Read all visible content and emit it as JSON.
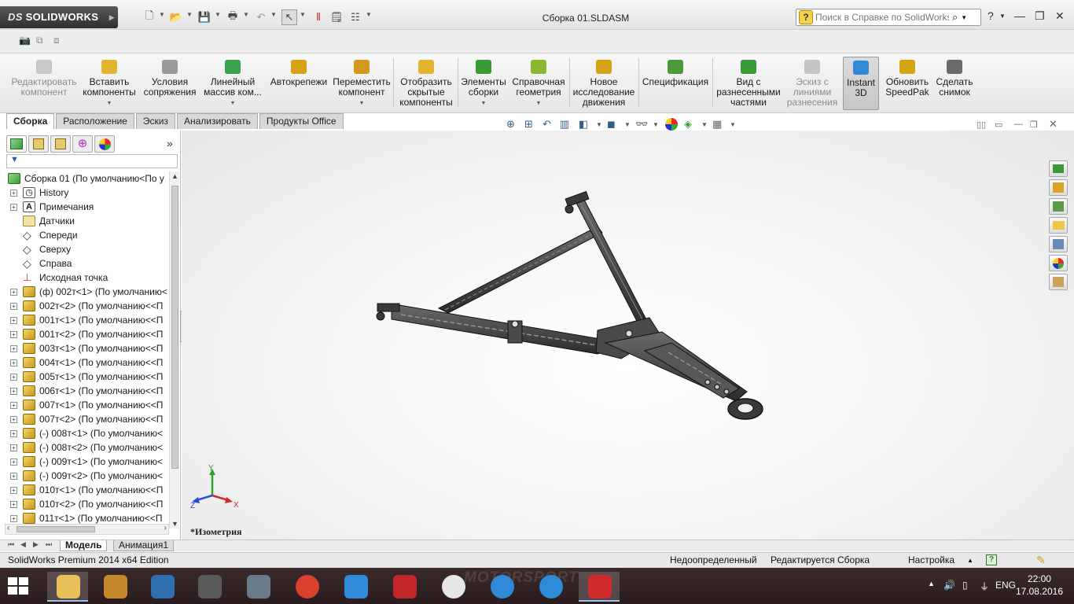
{
  "app": {
    "logo_text": "SOLIDWORKS",
    "logo_prefix": "DS",
    "document_title": "Сборка 01.SLDASM"
  },
  "help_search": {
    "placeholder": "Поиск в Справке по SolidWorks",
    "icon": "question-icon"
  },
  "command_manager": {
    "items": [
      {
        "label": "Редактировать\nкомпонент",
        "enabled": false,
        "dropdown": false,
        "icon_color": "#bdbdbd"
      },
      {
        "label": "Вставить\nкомпоненты",
        "enabled": true,
        "dropdown": true,
        "icon_color": "#e2b530"
      },
      {
        "label": "Условия\nсопряжения",
        "enabled": true,
        "dropdown": false,
        "icon_color": "#7a7a7a"
      },
      {
        "label": "Линейный\nмассив ком...",
        "enabled": true,
        "dropdown": true,
        "icon_color": "#3aa34a"
      },
      {
        "label": "Автокрепежи",
        "enabled": true,
        "dropdown": false,
        "icon_color": "#d4a414"
      },
      {
        "label": "Переместить\nкомпонент",
        "enabled": true,
        "dropdown": true,
        "icon_color": "#d49a20"
      },
      {
        "label": "Отобразить\nскрытые\nкомпоненты",
        "enabled": true,
        "dropdown": false,
        "icon_color": "#e2b530"
      },
      {
        "label": "Элементы\nсборки",
        "enabled": true,
        "dropdown": true,
        "icon_color": "#3a9b35"
      },
      {
        "label": "Справочная\nгеометрия",
        "enabled": true,
        "dropdown": true,
        "icon_color": "#8ab832"
      },
      {
        "label": "Новое\nисследование\nдвижения",
        "enabled": true,
        "dropdown": false,
        "icon_color": "#d4a414"
      },
      {
        "label": "Спецификация",
        "enabled": true,
        "dropdown": false,
        "icon_color": "#4a9a3a"
      },
      {
        "label": "Вид с\nразнесенными\nчастями",
        "enabled": true,
        "dropdown": false,
        "icon_color": "#3a9b35"
      },
      {
        "label": "Эскиз с\nлиниями\nразнесения",
        "enabled": false,
        "dropdown": false,
        "icon_color": "#c4c4c4"
      },
      {
        "label": "Instant\n3D",
        "enabled": true,
        "dropdown": false,
        "active": true,
        "icon_color": "#2f8ad8"
      },
      {
        "label": "Обновить\nSpeedPak",
        "enabled": true,
        "dropdown": false,
        "icon_color": "#d4a414"
      },
      {
        "label": "Сделать\nснимок",
        "enabled": true,
        "dropdown": false,
        "icon_color": "#6a6a6a"
      }
    ]
  },
  "tabs": [
    {
      "label": "Сборка",
      "active": true
    },
    {
      "label": "Расположение",
      "active": false
    },
    {
      "label": "Эскиз",
      "active": false
    },
    {
      "label": "Анализировать",
      "active": false
    },
    {
      "label": "Продукты Office",
      "active": false
    }
  ],
  "feature_tree": {
    "root": "Сборка 01  (По умолчанию<По у",
    "items": [
      {
        "label": "History",
        "icon": "history-icon",
        "expand": true
      },
      {
        "label": "Примечания",
        "icon": "annotations-icon",
        "expand": true
      },
      {
        "label": "Датчики",
        "icon": "sensors-icon",
        "expand": false
      },
      {
        "label": "Спереди",
        "icon": "plane-icon",
        "expand": false
      },
      {
        "label": "Сверху",
        "icon": "plane-icon",
        "expand": false
      },
      {
        "label": "Справа",
        "icon": "plane-icon",
        "expand": false
      },
      {
        "label": "Исходная точка",
        "icon": "origin-icon",
        "expand": false
      },
      {
        "label": "(ф) 002т<1> (По умолчанию<",
        "icon": "assembly-icon",
        "expand": true
      },
      {
        "label": "002т<2> (По умолчанию<<П",
        "icon": "assembly-icon",
        "expand": true
      },
      {
        "label": "001т<1> (По умолчанию<<П",
        "icon": "assembly-icon",
        "expand": true
      },
      {
        "label": "001т<2> (По умолчанию<<П",
        "icon": "assembly-icon",
        "expand": true
      },
      {
        "label": "003т<1> (По умолчанию<<П",
        "icon": "assembly-icon",
        "expand": true
      },
      {
        "label": "004т<1> (По умолчанию<<П",
        "icon": "assembly-icon",
        "expand": true
      },
      {
        "label": "005т<1> (По умолчанию<<П",
        "icon": "assembly-icon",
        "expand": true
      },
      {
        "label": "006т<1> (По умолчанию<<П",
        "icon": "assembly-icon",
        "expand": true
      },
      {
        "label": "007т<1> (По умолчанию<<П",
        "icon": "assembly-icon",
        "expand": true
      },
      {
        "label": "007т<2> (По умолчанию<<П",
        "icon": "assembly-icon",
        "expand": true
      },
      {
        "label": "(-) 008т<1> (По умолчанию<",
        "icon": "assembly-icon",
        "expand": true
      },
      {
        "label": "(-) 008т<2> (По умолчанию<",
        "icon": "assembly-icon",
        "expand": true
      },
      {
        "label": "(-) 009т<1> (По умолчанию<",
        "icon": "assembly-icon",
        "expand": true
      },
      {
        "label": "(-) 009т<2> (По умолчанию<",
        "icon": "assembly-icon",
        "expand": true
      },
      {
        "label": "010т<1> (По умолчанию<<П",
        "icon": "assembly-icon",
        "expand": true
      },
      {
        "label": "010т<2> (По умолчанию<<П",
        "icon": "assembly-icon",
        "expand": true
      },
      {
        "label": "011т<1> (По умолчанию<<П",
        "icon": "assembly-icon",
        "expand": true
      }
    ]
  },
  "viewport": {
    "view_label": "*Изометрия",
    "triad": {
      "x": "X",
      "y": "Y",
      "z": "Z"
    }
  },
  "bottom_tabs": [
    {
      "label": "Модель",
      "active": true
    },
    {
      "label": "Анимация1",
      "active": false
    }
  ],
  "status_bar": {
    "edition": "SolidWorks Premium 2014 x64 Edition",
    "definition": "Недоопределенный",
    "editing": "Редактируется Сборка",
    "settings": "Настройка"
  },
  "taskbar": {
    "watermark": "MOTORSPORT",
    "language": "ENG",
    "time": "22:00",
    "date": "17.08.2016",
    "apps": [
      {
        "name": "explorer",
        "color": "#e8c15a",
        "active": true
      },
      {
        "name": "app-2",
        "color": "#c4882a",
        "active": false
      },
      {
        "name": "app-3",
        "color": "#2f6fb0",
        "active": false
      },
      {
        "name": "app-4",
        "color": "#5a5a5a",
        "active": false
      },
      {
        "name": "app-5",
        "color": "#6a7a8a",
        "active": false
      },
      {
        "name": "chrome",
        "color": "#d9402e",
        "active": false
      },
      {
        "name": "app-7",
        "color": "#2f8ad8",
        "active": false
      },
      {
        "name": "app-8",
        "color": "#c0262a",
        "active": false
      },
      {
        "name": "yandex",
        "color": "#e6e6e6",
        "active": false
      },
      {
        "name": "app-10",
        "color": "#2f8ad8",
        "active": false
      },
      {
        "name": "app-11",
        "color": "#2f8ad8",
        "active": false
      },
      {
        "name": "solidworks",
        "color": "#d02a2a",
        "active": true
      }
    ]
  }
}
